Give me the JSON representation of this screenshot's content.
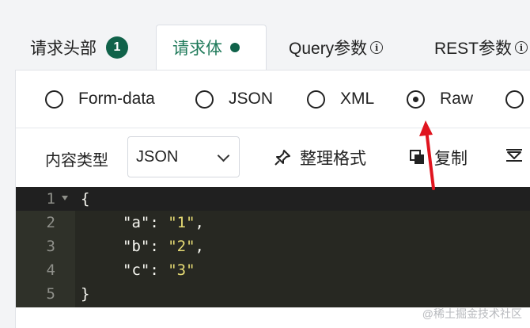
{
  "tabs": [
    {
      "label": "请求头部",
      "badge": "1"
    },
    {
      "label": "请求体"
    },
    {
      "label": "Query参数",
      "info": "i"
    },
    {
      "label": "REST参数",
      "info": "i"
    }
  ],
  "body_types": [
    {
      "label": "Form-data",
      "checked": false
    },
    {
      "label": "JSON",
      "checked": false
    },
    {
      "label": "XML",
      "checked": false
    },
    {
      "label": "Raw",
      "checked": true
    },
    {
      "label": "",
      "checked": false
    }
  ],
  "toolbar": {
    "content_type_label": "内容类型",
    "content_type_value": "JSON",
    "format_label": "整理格式",
    "copy_label": "复制"
  },
  "editor": {
    "lines": [
      {
        "n": "1",
        "fold": true
      },
      {
        "n": "2",
        "key": "\"a\"",
        "value": "\"1\""
      },
      {
        "n": "3",
        "key": "\"b\"",
        "value": "\"2\""
      },
      {
        "n": "4",
        "key": "\"c\"",
        "value": "\"3\""
      },
      {
        "n": "5"
      }
    ],
    "open_brace": "{",
    "close_brace": "}"
  },
  "watermark": "@稀土掘金技术社区",
  "colors": {
    "accent": "#10624a",
    "annotation_arrow": "#e0141e"
  }
}
